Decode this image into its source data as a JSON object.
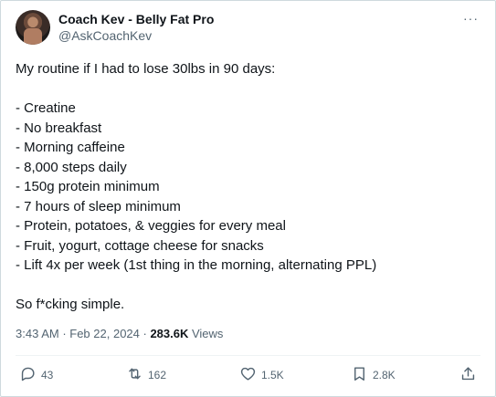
{
  "author": {
    "display_name": "Coach Kev - Belly Fat Pro",
    "handle": "@AskCoachKev",
    "more_label": "···"
  },
  "post": {
    "intro": "My routine if I had to lose 30lbs in 90 days:",
    "items": [
      "- Creatine",
      "- No breakfast",
      "- Morning caffeine",
      "- 8,000 steps daily",
      "- 150g protein minimum",
      "- 7 hours of sleep minimum",
      "- Protein, potatoes, & veggies for every meal",
      "- Fruit, yogurt, cottage cheese for snacks",
      "- Lift 4x per week (1st thing in the morning, alternating PPL)"
    ],
    "closing": "So f*cking simple."
  },
  "meta": {
    "time": "3:43 AM",
    "separator": " · ",
    "date": "Feb 22, 2024",
    "separator2": " · ",
    "views_count": "283.6K",
    "views_label": " Views"
  },
  "actions": {
    "replies": "43",
    "reposts": "162",
    "likes": "1.5K",
    "bookmarks": "2.8K"
  },
  "colors": {
    "text": "#0f1419",
    "secondary": "#536471",
    "border": "#cfd9de"
  }
}
